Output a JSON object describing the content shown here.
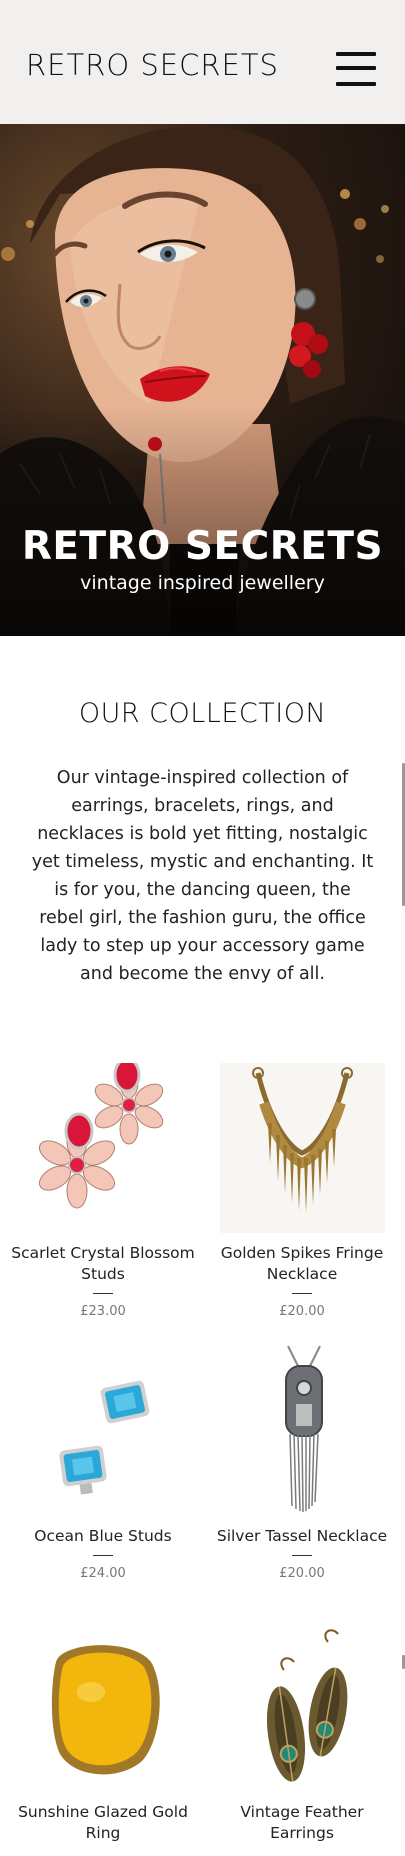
{
  "header": {
    "brand": "RETRO SECRETS"
  },
  "hero": {
    "title": "RETRO SECRETS",
    "subtitle": "vintage inspired jewellery"
  },
  "collection": {
    "title": "OUR COLLECTION",
    "text": "Our vintage-inspired collection of earrings, bracelets, rings, and necklaces is bold yet fitting, nostalgic yet timeless, mystic and enchanting. It is for you, the dancing queen, the rebel girl, the fashion guru, the office lady to step up your accessory game and become the envy of all."
  },
  "products": [
    {
      "name": "Scarlet Crystal Blossom Studs",
      "price": "£23.00",
      "image": "red-crystal-earrings"
    },
    {
      "name": "Golden Spikes Fringe Necklace",
      "price": "£20.00",
      "image": "gold-spike-necklace"
    },
    {
      "name": "Ocean Blue Studs",
      "price": "£24.00",
      "image": "blue-gem-studs"
    },
    {
      "name": "Silver Tassel Necklace",
      "price": "£20.00",
      "image": "silver-tassel-necklace"
    },
    {
      "name": "Sunshine Glazed Gold Ring",
      "price": "",
      "image": "yellow-gold-ring"
    },
    {
      "name": "Vintage Feather Earrings",
      "price": "",
      "image": "feather-earrings"
    }
  ],
  "colors": {
    "header_bg": "#f1f0ee",
    "text": "#222222",
    "price": "#777777"
  }
}
